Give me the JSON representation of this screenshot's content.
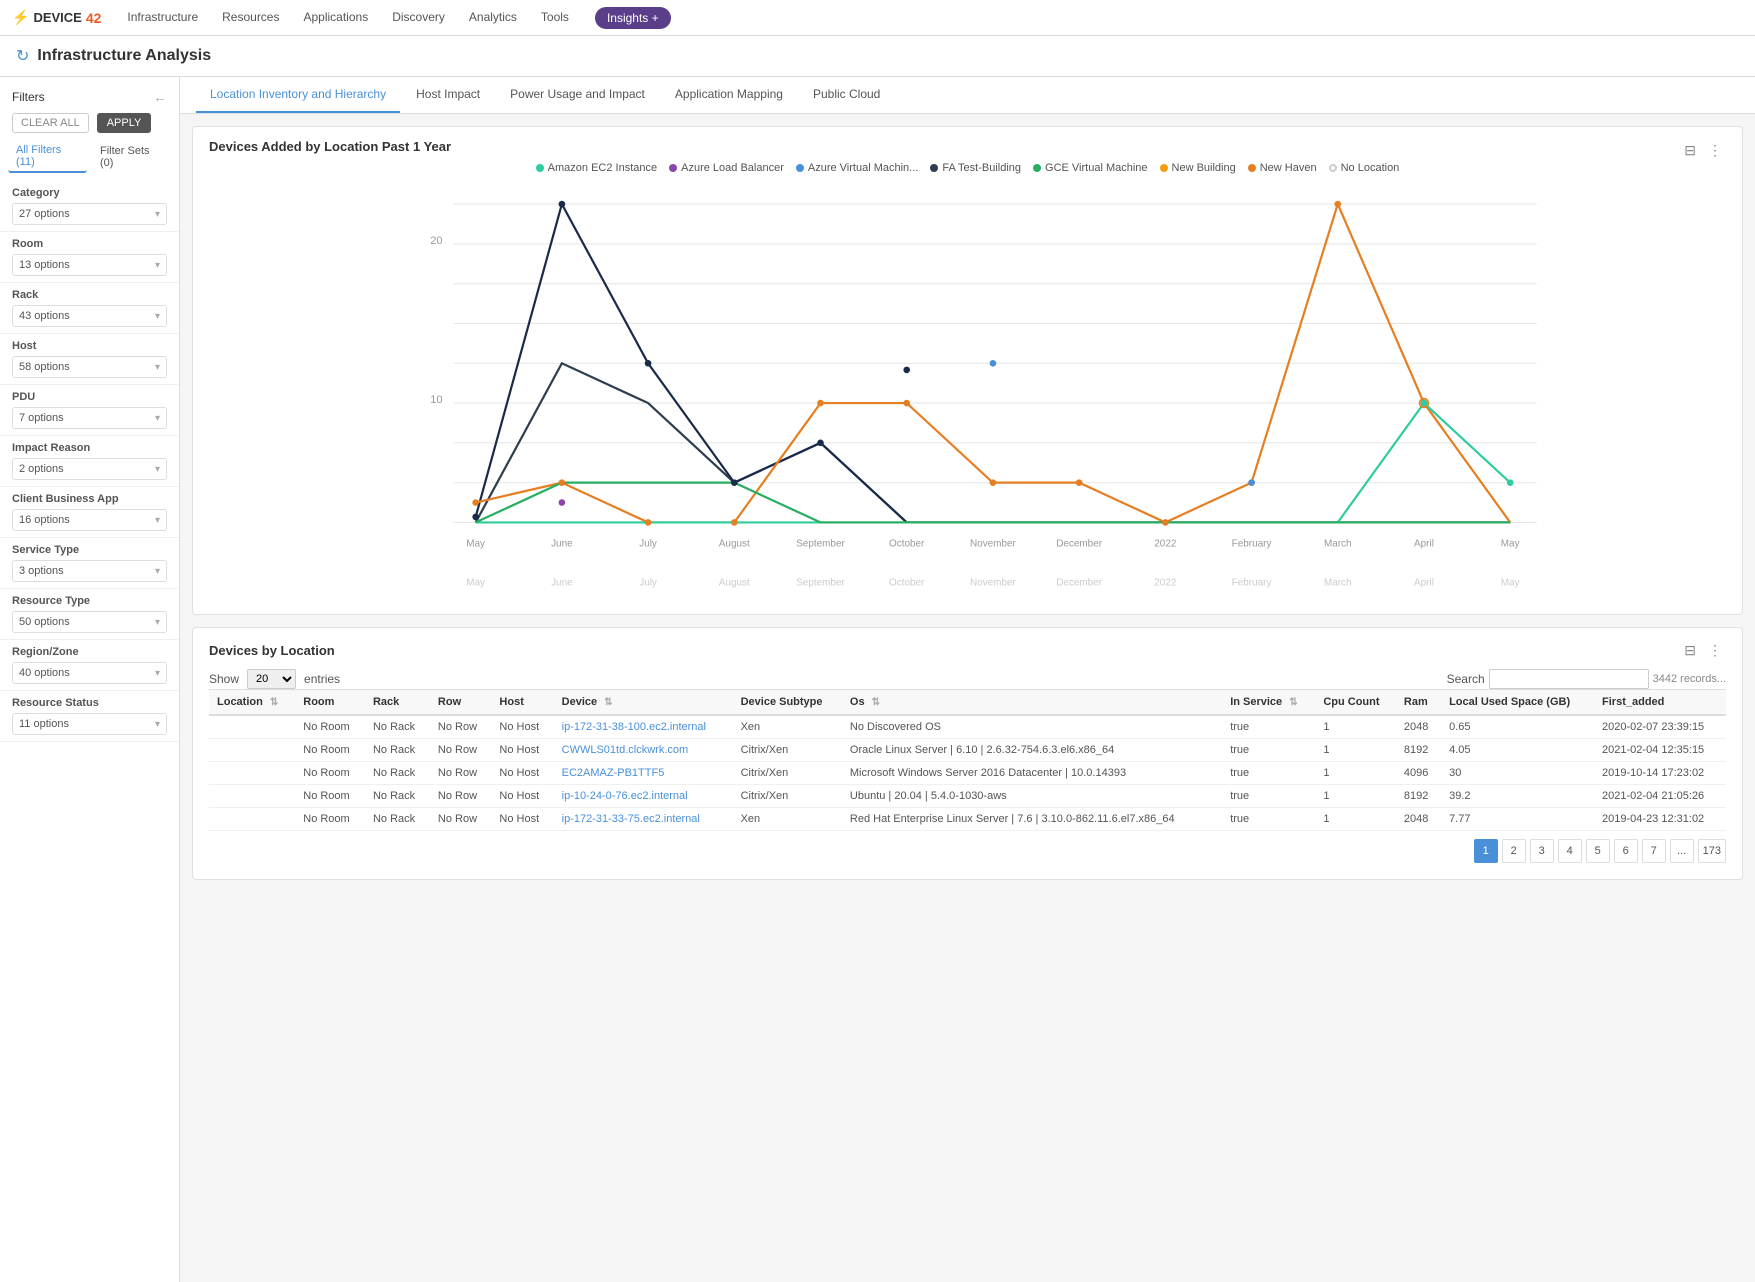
{
  "brand": {
    "logo": "DEVICE42",
    "logo_accent": "42"
  },
  "top_nav": {
    "items": [
      {
        "label": "Infrastructure",
        "active": false
      },
      {
        "label": "Resources",
        "active": false
      },
      {
        "label": "Applications",
        "active": false
      },
      {
        "label": "Discovery",
        "active": false
      },
      {
        "label": "Analytics",
        "active": false
      },
      {
        "label": "Tools",
        "active": false
      }
    ],
    "insights_label": "Insights +"
  },
  "page": {
    "title": "Infrastructure Analysis",
    "refresh_tooltip": "Refresh"
  },
  "sidebar": {
    "title": "Filters",
    "collapse_label": "←",
    "clear_label": "CLEAR ALL",
    "apply_label": "APPLY",
    "active_tab": "All Filters (11)",
    "filter_sets_tab": "Filter Sets (0)",
    "filters": [
      {
        "label": "Category",
        "options": "27 options"
      },
      {
        "label": "Room",
        "options": "13 options"
      },
      {
        "label": "Rack",
        "options": "43 options"
      },
      {
        "label": "Host",
        "options": "58 options"
      },
      {
        "label": "PDU",
        "options": "7 options"
      },
      {
        "label": "Impact Reason",
        "options": "2 options"
      },
      {
        "label": "Client Business App",
        "options": "16 options"
      },
      {
        "label": "Service Type",
        "options": "3 options"
      },
      {
        "label": "Resource Type",
        "options": "50 options"
      },
      {
        "label": "Region/Zone",
        "options": "40 options"
      },
      {
        "label": "Resource Status",
        "options": "11 options"
      }
    ]
  },
  "sub_tabs": [
    {
      "label": "Location Inventory and Hierarchy",
      "active": true
    },
    {
      "label": "Host Impact",
      "active": false
    },
    {
      "label": "Power Usage and Impact",
      "active": false
    },
    {
      "label": "Application Mapping",
      "active": false
    },
    {
      "label": "Public Cloud",
      "active": false
    }
  ],
  "chart": {
    "title": "Devices Added by Location Past 1 Year",
    "legend": [
      {
        "label": "Amazon EC2 Instance",
        "color": "#2ecc9e",
        "type": "dot"
      },
      {
        "label": "Azure Load Balancer",
        "color": "#8e44ad",
        "type": "dot"
      },
      {
        "label": "Azure Virtual Machin...",
        "color": "#4a90d9",
        "type": "dot"
      },
      {
        "label": "FA Test-Building",
        "color": "#2c3e50",
        "type": "dot"
      },
      {
        "label": "GCE Virtual Machine",
        "color": "#27ae60",
        "type": "dot"
      },
      {
        "label": "New Building",
        "color": "#f39c12",
        "type": "dot"
      },
      {
        "label": "New Haven",
        "color": "#e67e22",
        "type": "dot"
      },
      {
        "label": "No Location",
        "color": "#cccccc",
        "type": "ring"
      }
    ],
    "x_labels": [
      "May",
      "June",
      "July",
      "August",
      "September",
      "October",
      "November",
      "December",
      "2022",
      "February",
      "March",
      "April",
      "May"
    ],
    "y_max": 10
  },
  "devices_table": {
    "title": "Devices by Location",
    "show_label": "Show",
    "show_value": "20",
    "entries_label": "entries",
    "search_label": "Search",
    "records_count": "3442 records...",
    "columns": [
      {
        "label": "Location",
        "sortable": true
      },
      {
        "label": "Room",
        "sortable": false
      },
      {
        "label": "Rack",
        "sortable": false
      },
      {
        "label": "Row",
        "sortable": false
      },
      {
        "label": "Host",
        "sortable": false
      },
      {
        "label": "Device",
        "sortable": true
      },
      {
        "label": "Device Subtype",
        "sortable": false
      },
      {
        "label": "Os",
        "sortable": true
      },
      {
        "label": "In Service",
        "sortable": true
      },
      {
        "label": "Cpu Count",
        "sortable": false
      },
      {
        "label": "Ram",
        "sortable": false
      },
      {
        "label": "Local Used Space (GB)",
        "sortable": false
      },
      {
        "label": "First_added",
        "sortable": false
      }
    ],
    "rows": [
      {
        "location": "",
        "room": "No Room",
        "rack": "No Rack",
        "row": "No Row",
        "host": "No Host",
        "device": "ip-172-31-38-100.ec2.internal",
        "device_link": true,
        "device_subtype": "Xen",
        "os": "No Discovered OS",
        "in_service": "true",
        "cpu_count": "1",
        "ram": "2048",
        "local_used_space": "0.65",
        "first_added": "2020-02-07 23:39:15"
      },
      {
        "location": "",
        "room": "No Room",
        "rack": "No Rack",
        "row": "No Row",
        "host": "No Host",
        "device": "CWWLS01td.clckwrk.com",
        "device_link": true,
        "device_subtype": "Citrix/Xen",
        "os": "Oracle Linux Server | 6.10 | 2.6.32-754.6.3.el6.x86_64",
        "in_service": "true",
        "cpu_count": "1",
        "ram": "8192",
        "local_used_space": "4.05",
        "first_added": "2021-02-04 12:35:15"
      },
      {
        "location": "",
        "room": "No Room",
        "rack": "No Rack",
        "row": "No Row",
        "host": "No Host",
        "device": "EC2AMAZ-PB1TTF5",
        "device_link": true,
        "device_subtype": "Citrix/Xen",
        "os": "Microsoft Windows Server 2016 Datacenter | 10.0.14393",
        "in_service": "true",
        "cpu_count": "1",
        "ram": "4096",
        "local_used_space": "30",
        "first_added": "2019-10-14 17:23:02"
      },
      {
        "location": "",
        "room": "No Room",
        "rack": "No Rack",
        "row": "No Row",
        "host": "No Host",
        "device": "ip-10-24-0-76.ec2.internal",
        "device_link": true,
        "device_subtype": "Citrix/Xen",
        "os": "Ubuntu | 20.04 | 5.4.0-1030-aws",
        "in_service": "true",
        "cpu_count": "1",
        "ram": "8192",
        "local_used_space": "39.2",
        "first_added": "2021-02-04 21:05:26"
      },
      {
        "location": "",
        "room": "No Room",
        "rack": "No Rack",
        "row": "No Row",
        "host": "No Host",
        "device": "ip-172-31-33-75.ec2.internal",
        "device_link": true,
        "device_subtype": "Xen",
        "os": "Red Hat Enterprise Linux Server | 7.6 | 3.10.0-862.11.6.el7.x86_64",
        "in_service": "true",
        "cpu_count": "1",
        "ram": "2048",
        "local_used_space": "7.77",
        "first_added": "2019-04-23 12:31:02"
      }
    ],
    "pagination": {
      "current": 1,
      "pages": [
        "1",
        "2",
        "3",
        "4",
        "5",
        "6",
        "7",
        "...",
        "173"
      ]
    }
  }
}
